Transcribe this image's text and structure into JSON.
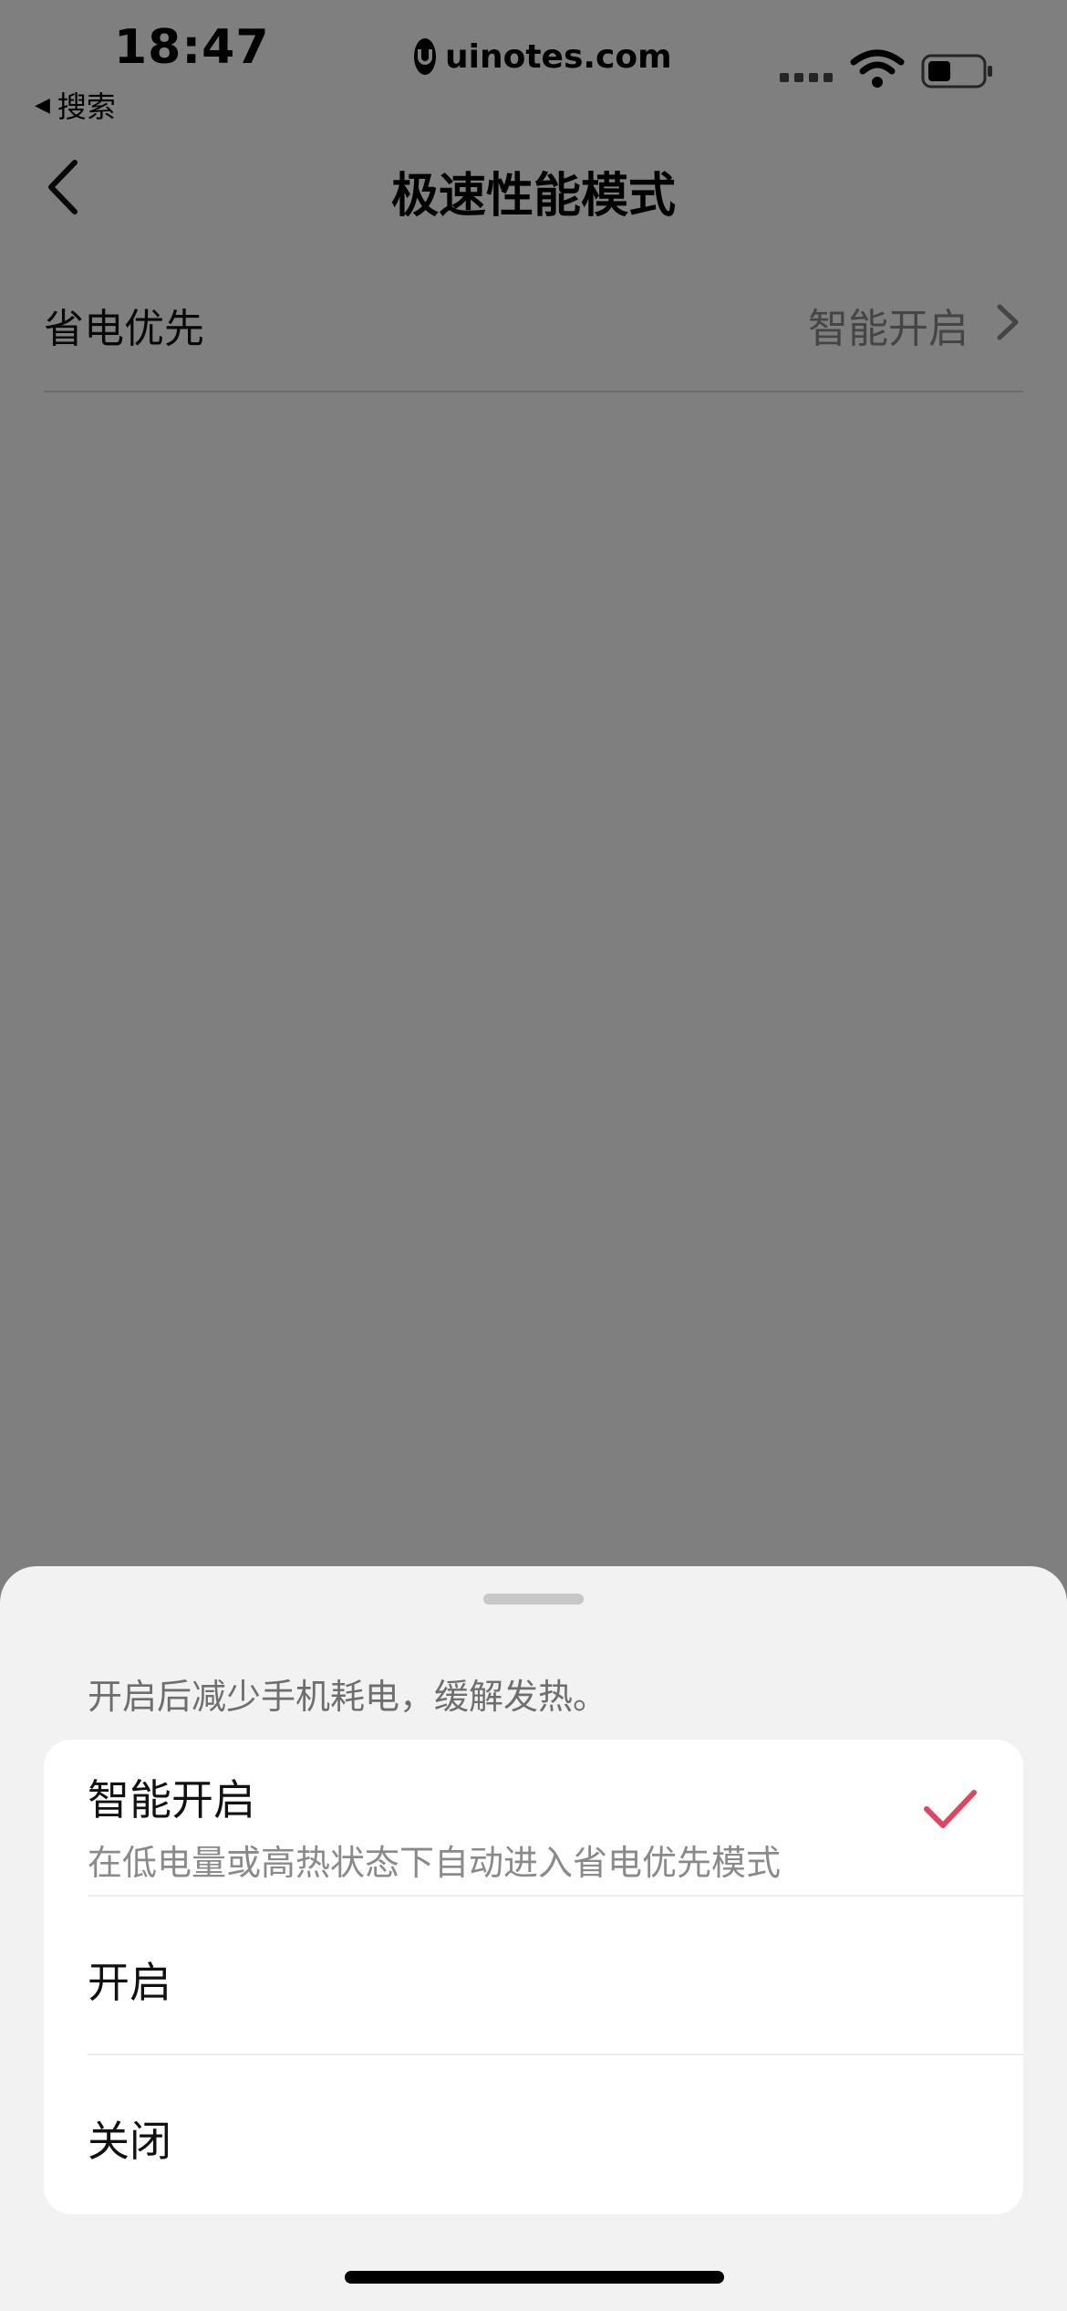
{
  "status_bar": {
    "time": "18:47",
    "back_app_label": "搜索",
    "watermark": "uinotes.com"
  },
  "nav": {
    "title": "极速性能模式"
  },
  "setting": {
    "label": "省电优先",
    "value": "智能开启"
  },
  "sheet": {
    "description": "开启后减少手机耗电，缓解发热。",
    "options": [
      {
        "title": "智能开启",
        "subtitle": "在低电量或高热状态下自动进入省电优先模式",
        "selected": true
      },
      {
        "title": "开启",
        "selected": false
      },
      {
        "title": "关闭",
        "selected": false
      }
    ]
  },
  "colors": {
    "accent_check": "#e0455f",
    "overlay": "rgba(0,0,0,0.5)",
    "sheet_bg": "#f2f2f2"
  }
}
